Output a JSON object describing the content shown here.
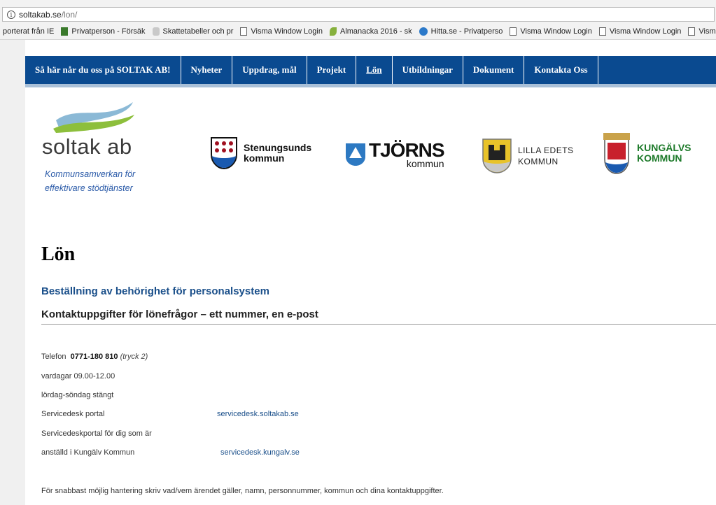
{
  "browser": {
    "url_domain": "soltakab.se",
    "url_path": "/lon/",
    "bookmarks": [
      {
        "label": "porterat från IE",
        "icon": "none"
      },
      {
        "label": "Privatperson - Försäk",
        "icon": "green-logo-icon"
      },
      {
        "label": "Skattetabeller och pr",
        "icon": "tax-icon"
      },
      {
        "label": "Visma Window Login",
        "icon": "page-icon"
      },
      {
        "label": "Almanacka 2016 - sk",
        "icon": "leaf-icon"
      },
      {
        "label": "Hitta.se - Privatperso",
        "icon": "globe-icon"
      },
      {
        "label": "Visma Window Login",
        "icon": "page-icon"
      },
      {
        "label": "Visma Window Login",
        "icon": "page-icon"
      },
      {
        "label": "Visma Window Login",
        "icon": "page-icon"
      }
    ]
  },
  "nav": {
    "items": [
      {
        "label": "Så här når du oss på SOLTAK AB!"
      },
      {
        "label": "Nyheter"
      },
      {
        "label": "Uppdrag, mål"
      },
      {
        "label": "Projekt"
      },
      {
        "label": "Lön"
      },
      {
        "label": "Utbildningar"
      },
      {
        "label": "Dokument"
      },
      {
        "label": "Kontakta Oss"
      }
    ],
    "active_index": 4
  },
  "logos": {
    "soltak_name": "soltak ab",
    "soltak_tag_line1": "Kommunsamverkan för",
    "soltak_tag_line2": "effektivare stödtjänster",
    "stenungsund_line1": "Stenungsunds",
    "stenungsund_line2": "kommun",
    "tjorn_line1": "TJÖRNS",
    "tjorn_line2": "kommun",
    "lilla_edet_line1": "LILLA EDETS",
    "lilla_edet_line2": "KOMMUN",
    "kungalv_line1": "KUNGÄLVS",
    "kungalv_line2": "KOMMUN"
  },
  "content": {
    "title": "Lön",
    "link_heading": "Beställning av behörighet för personalsystem",
    "subheading": "Kontaktuppgifter för lönefrågor – ett nummer, en e-post",
    "phone_label": "Telefon",
    "phone_number": "0771-180 810",
    "phone_note": "(tryck 2)",
    "hours_weekdays": "vardagar 09.00-12.00",
    "hours_weekend": "lördag-söndag stängt",
    "servicedesk_label": "Servicedesk portal",
    "servicedesk_link": "servicedesk.soltakab.se",
    "kungalv_label_line1": "Servicedeskportal för dig som är",
    "kungalv_label_line2": "anställd i Kungälv Kommun",
    "kungalv_link": "servicedesk.kungalv.se",
    "footer_note": "För snabbast möjlig hantering skriv vad/vem ärendet gäller, namn, personnummer, kommun och dina kontaktuppgifter."
  },
  "colors": {
    "nav_bg": "#0a4a90",
    "link": "#1a4f8a",
    "kungalv_green": "#1d7a2a"
  }
}
